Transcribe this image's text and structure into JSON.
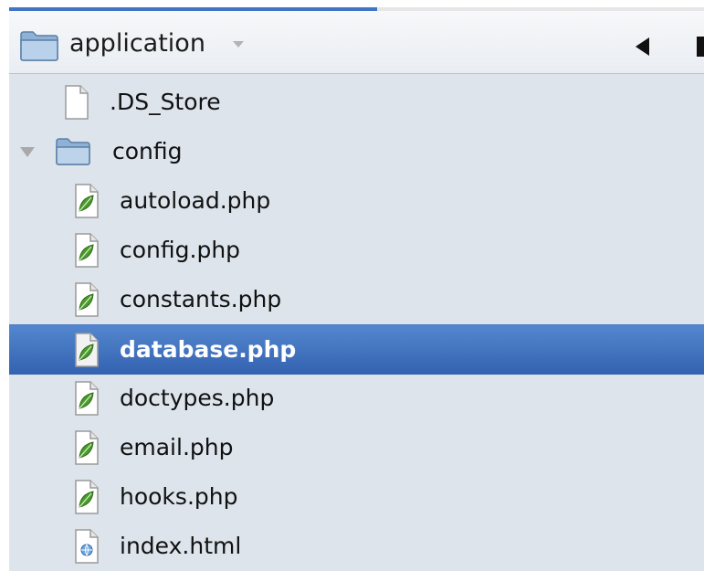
{
  "header": {
    "title": "application",
    "progress_fraction": 0.53,
    "folder_icon": "folder-icon",
    "dropdown_icon": "chevron-down-icon",
    "back_icon": "back-arrow-icon",
    "forward_icon": "forward-arrow-icon"
  },
  "colors": {
    "pane_background": "#dde4ec",
    "selection": "#3f70bf",
    "leaf_green": "#4a9a2c"
  },
  "tree": {
    "items": [
      {
        "label": ".DS_Store",
        "icon": "blank-file-icon",
        "selected": false
      },
      {
        "label": "config",
        "icon": "folder-icon",
        "expanded": true,
        "selected": false
      },
      {
        "label": "autoload.php",
        "icon": "php-file-icon",
        "selected": false
      },
      {
        "label": "config.php",
        "icon": "php-file-icon",
        "selected": false
      },
      {
        "label": "constants.php",
        "icon": "php-file-icon",
        "selected": false
      },
      {
        "label": "database.php",
        "icon": "php-file-icon",
        "selected": true
      },
      {
        "label": "doctypes.php",
        "icon": "php-file-icon",
        "selected": false
      },
      {
        "label": "email.php",
        "icon": "php-file-icon",
        "selected": false
      },
      {
        "label": "hooks.php",
        "icon": "php-file-icon",
        "selected": false
      },
      {
        "label": "index.html",
        "icon": "html-file-icon",
        "selected": false
      }
    ]
  }
}
